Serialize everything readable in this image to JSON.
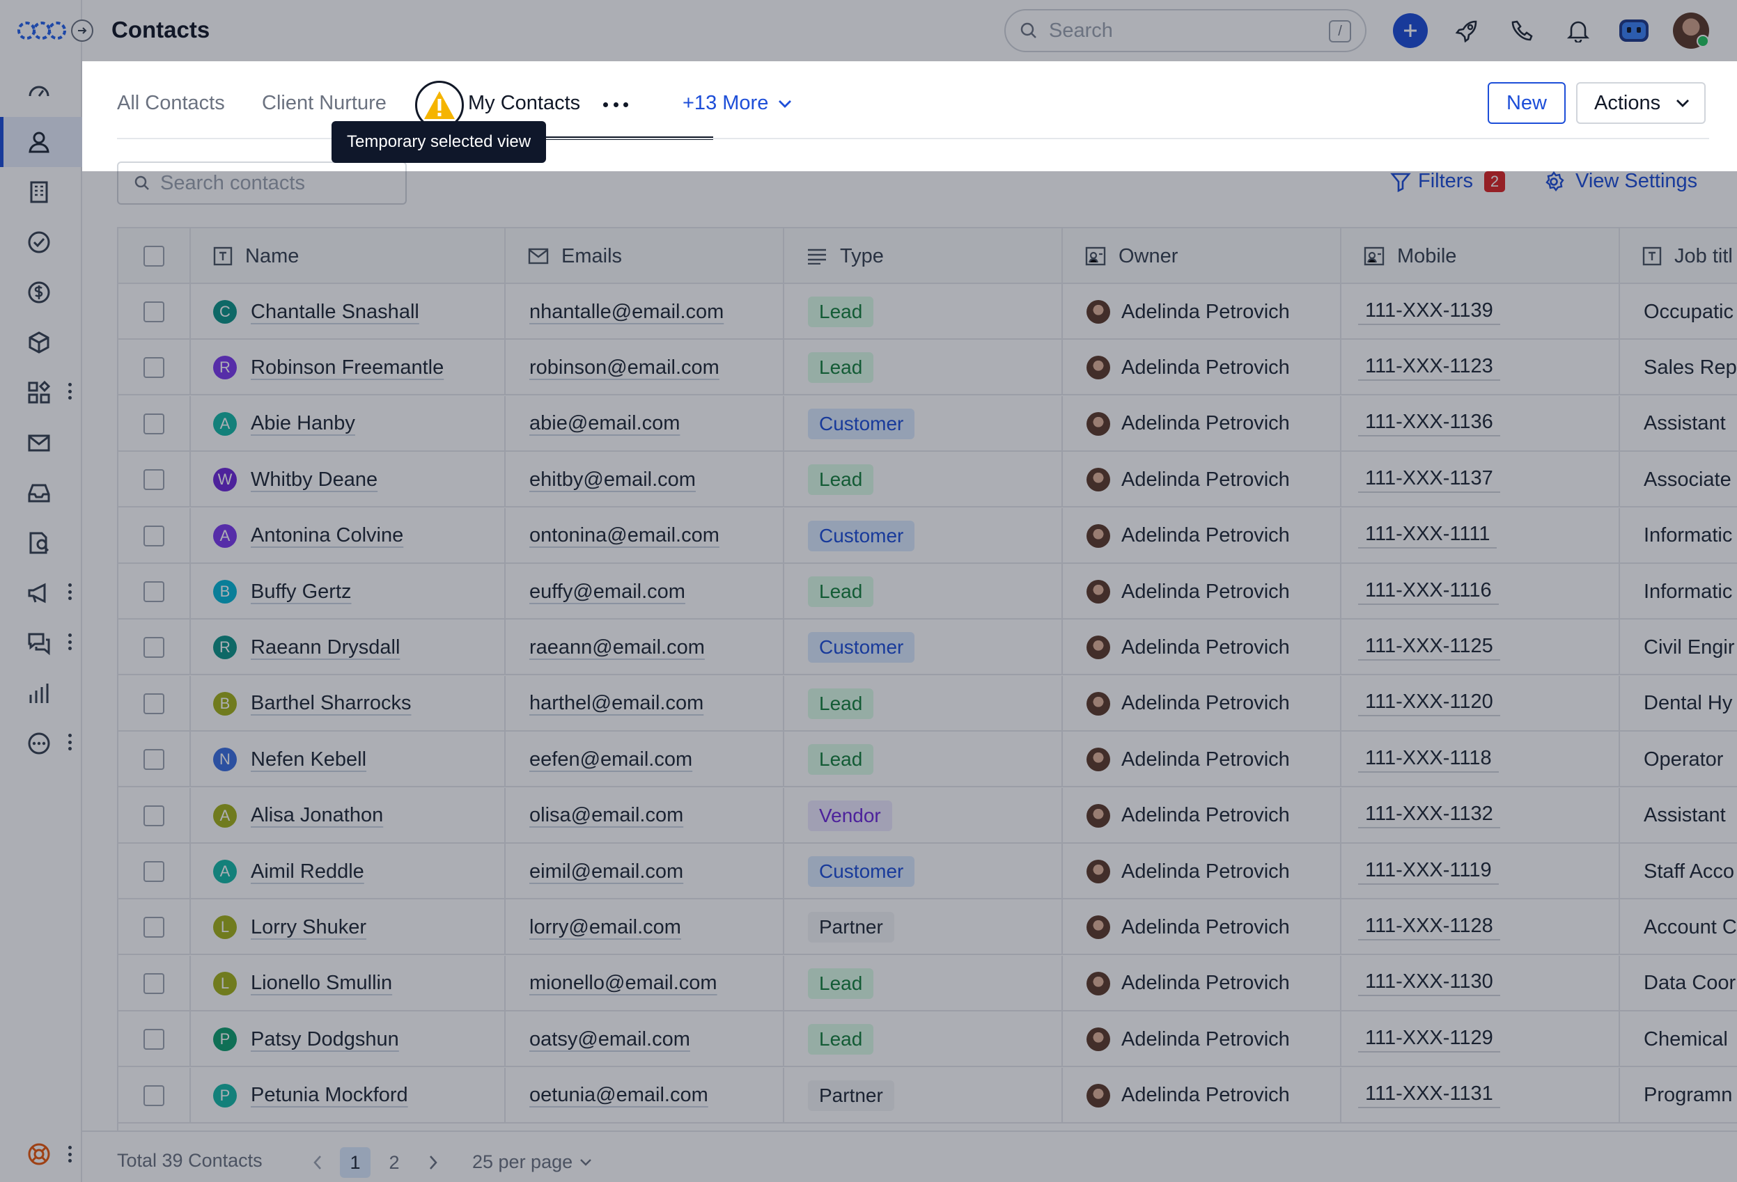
{
  "header": {
    "title": "Contacts",
    "search_placeholder": "Search",
    "search_shortcut": "/"
  },
  "views": {
    "tabs": [
      {
        "label": "All Contacts"
      },
      {
        "label": "Client Nurture"
      },
      {
        "label": "My Contacts"
      }
    ],
    "more_label": "+13 More",
    "tooltip": "Temporary selected view",
    "new_label": "New",
    "actions_label": "Actions"
  },
  "toolbar": {
    "search_placeholder": "Search contacts",
    "filters_label": "Filters",
    "filters_count": "2",
    "view_settings_label": "View Settings"
  },
  "table": {
    "columns": [
      "Name",
      "Emails",
      "Type",
      "Owner",
      "Mobile",
      "Job titl"
    ],
    "rows": [
      {
        "initial": "C",
        "color": "#0d9488",
        "name": "Chantalle Snashall",
        "email": "nhantalle@email.com",
        "type": "Lead",
        "owner": "Adelinda Petrovich",
        "mobile": "111-XXX-1139",
        "job": "Occupatic"
      },
      {
        "initial": "R",
        "color": "#7c3aed",
        "name": "Robinson Freemantle",
        "email": "robinson@email.com",
        "type": "Lead",
        "owner": "Adelinda Petrovich",
        "mobile": "111-XXX-1123",
        "job": "Sales Rep"
      },
      {
        "initial": "A",
        "color": "#14b8a6",
        "name": "Abie Hanby",
        "email": "abie@email.com",
        "type": "Customer",
        "owner": "Adelinda Petrovich",
        "mobile": "111-XXX-1136",
        "job": "Assistant"
      },
      {
        "initial": "W",
        "color": "#6d28d9",
        "name": "Whitby Deane",
        "email": "ehitby@email.com",
        "type": "Lead",
        "owner": "Adelinda Petrovich",
        "mobile": "111-XXX-1137",
        "job": "Associate"
      },
      {
        "initial": "A",
        "color": "#7c3aed",
        "name": "Antonina Colvine",
        "email": "ontonina@email.com",
        "type": "Customer",
        "owner": "Adelinda Petrovich",
        "mobile": "111-XXX-1111",
        "job": "Informatic"
      },
      {
        "initial": "B",
        "color": "#06b6d4",
        "name": "Buffy Gertz",
        "email": "euffy@email.com",
        "type": "Lead",
        "owner": "Adelinda Petrovich",
        "mobile": "111-XXX-1116",
        "job": "Informatic"
      },
      {
        "initial": "R",
        "color": "#0d9488",
        "name": "Raeann Drysdall",
        "email": "raeann@email.com",
        "type": "Customer",
        "owner": "Adelinda Petrovich",
        "mobile": "111-XXX-1125",
        "job": "Civil Engir"
      },
      {
        "initial": "B",
        "color": "#a3b11a",
        "name": "Barthel Sharrocks",
        "email": "harthel@email.com",
        "type": "Lead",
        "owner": "Adelinda Petrovich",
        "mobile": "111-XXX-1120",
        "job": "Dental Hy"
      },
      {
        "initial": "N",
        "color": "#3b6fe0",
        "name": "Nefen Kebell",
        "email": "eefen@email.com",
        "type": "Lead",
        "owner": "Adelinda Petrovich",
        "mobile": "111-XXX-1118",
        "job": "Operator"
      },
      {
        "initial": "A",
        "color": "#a3b11a",
        "name": "Alisa Jonathon",
        "email": "olisa@email.com",
        "type": "Vendor",
        "owner": "Adelinda Petrovich",
        "mobile": "111-XXX-1132",
        "job": "Assistant"
      },
      {
        "initial": "A",
        "color": "#14b8a6",
        "name": "Aimil Reddle",
        "email": "eimil@email.com",
        "type": "Customer",
        "owner": "Adelinda Petrovich",
        "mobile": "111-XXX-1119",
        "job": "Staff Acco"
      },
      {
        "initial": "L",
        "color": "#a3b11a",
        "name": "Lorry Shuker",
        "email": "lorry@email.com",
        "type": "Partner",
        "owner": "Adelinda Petrovich",
        "mobile": "111-XXX-1128",
        "job": "Account C"
      },
      {
        "initial": "L",
        "color": "#a3b11a",
        "name": "Lionello Smullin",
        "email": "mionello@email.com",
        "type": "Lead",
        "owner": "Adelinda Petrovich",
        "mobile": "111-XXX-1130",
        "job": "Data Coor"
      },
      {
        "initial": "P",
        "color": "#0e9f6e",
        "name": "Patsy Dodgshun",
        "email": "oatsy@email.com",
        "type": "Lead",
        "owner": "Adelinda Petrovich",
        "mobile": "111-XXX-1129",
        "job": "Chemical"
      },
      {
        "initial": "P",
        "color": "#14b8a6",
        "name": "Petunia Mockford",
        "email": "oetunia@email.com",
        "type": "Partner",
        "owner": "Adelinda Petrovich",
        "mobile": "111-XXX-1131",
        "job": "Programn"
      }
    ]
  },
  "footer": {
    "total": "Total 39 Contacts",
    "pages": [
      "1",
      "2"
    ],
    "per_page": "25 per page"
  },
  "theme": {
    "accent": "#1d4ed8",
    "badge": "#dc2626"
  },
  "icons": [
    "logo-icon",
    "expand-icon",
    "dashboard-icon",
    "contacts-icon",
    "companies-icon",
    "tasks-icon",
    "deals-icon",
    "products-icon",
    "apps-icon",
    "email-icon",
    "inbox-icon",
    "documents-icon",
    "campaigns-icon",
    "conversations-icon",
    "reports-icon",
    "more-icon",
    "help-icon",
    "search-icon",
    "plus-icon",
    "rocket-icon",
    "phone-icon",
    "bell-icon",
    "assistant-icon",
    "avatar",
    "warning-icon",
    "filter-icon",
    "gear-icon",
    "chevron-down-icon"
  ]
}
